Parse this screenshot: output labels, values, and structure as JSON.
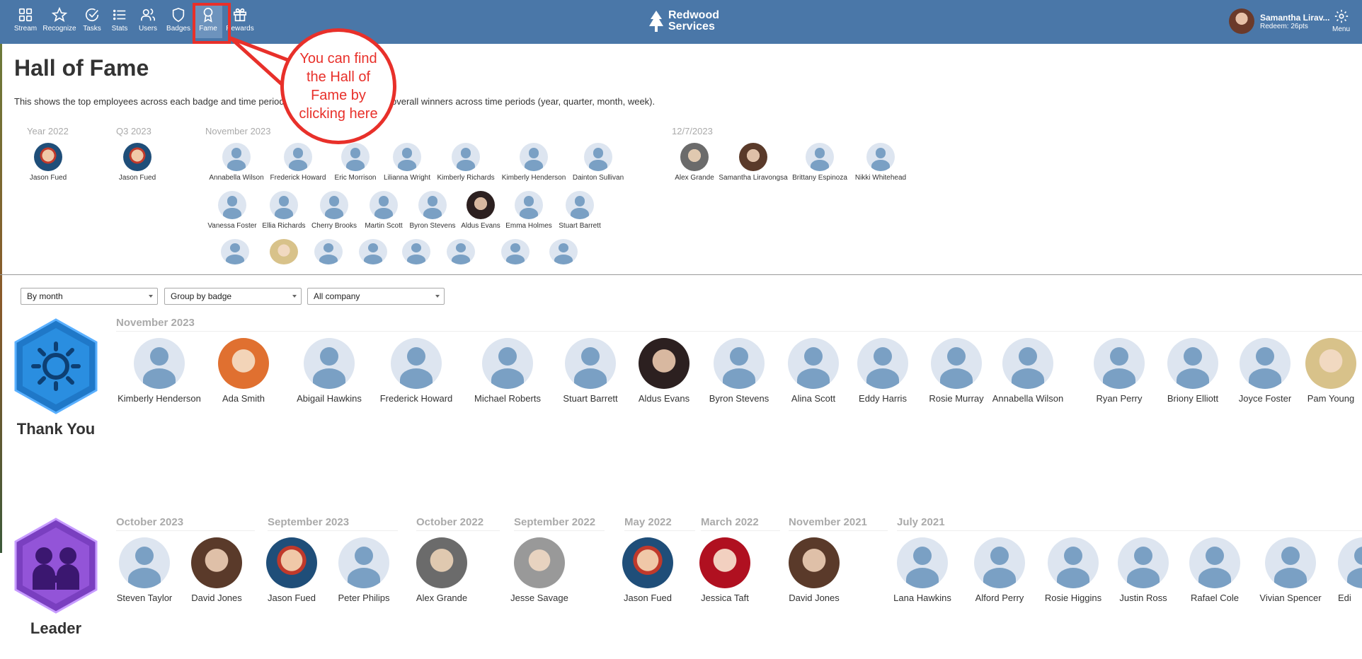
{
  "nav": {
    "items": [
      {
        "label": "Stream",
        "icon": "grid-icon"
      },
      {
        "label": "Recognize",
        "icon": "star-icon"
      },
      {
        "label": "Tasks",
        "icon": "check-circle-icon"
      },
      {
        "label": "Stats",
        "icon": "list-icon"
      },
      {
        "label": "Users",
        "icon": "users-icon"
      },
      {
        "label": "Badges",
        "icon": "shield-icon"
      },
      {
        "label": "Fame",
        "icon": "award-icon"
      },
      {
        "label": "Rewards",
        "icon": "gift-icon"
      }
    ],
    "active": "Fame"
  },
  "brand": {
    "line1": "Redwood",
    "line2": "Services"
  },
  "user": {
    "name": "Samantha Lirav...",
    "points": "Redeem: 26pts"
  },
  "menu": {
    "label": "Menu"
  },
  "page": {
    "title": "Hall of Fame",
    "desc_left": "This shows the top employees across each badge and time period",
    "desc_right": "ht is overall winners across time periods (year, quarter, month, week)."
  },
  "overview": {
    "year": {
      "label": "Year 2022",
      "people": [
        "Jason Fued"
      ]
    },
    "quarter": {
      "label": "Q3 2023",
      "people": [
        "Jason Fued"
      ]
    },
    "month": {
      "label": "November 2023",
      "row1": [
        "Annabella Wilson",
        "Frederick Howard",
        "Eric Morrison",
        "Lilianna Wright",
        "Kimberly Richards",
        "Kimberly Henderson",
        "Dainton Sullivan"
      ],
      "row2": [
        "Vanessa Foster",
        "Ellia Richards",
        "Cherry Brooks",
        "Martin Scott",
        "Byron Stevens",
        "Aldus Evans",
        "Emma Holmes",
        "Stuart Barrett"
      ]
    },
    "week": {
      "label": "12/7/2023",
      "people": [
        "Alex Grande",
        "Samantha Liravongsa",
        "Brittany Espinoza",
        "Nikki Whitehead"
      ]
    }
  },
  "filters": {
    "period": "By month",
    "group": "Group by badge",
    "scope": "All company"
  },
  "badges": {
    "thankyou": {
      "title": "Thank You",
      "period": "November 2023",
      "people": [
        "Kimberly Henderson",
        "Ada Smith",
        "Abigail Hawkins",
        "Frederick Howard",
        "Michael Roberts",
        "Stuart Barrett",
        "Aldus Evans",
        "Byron Stevens",
        "Alina Scott",
        "Eddy Harris",
        "Rosie Murray",
        "Annabella Wilson",
        "Ryan Perry",
        "Briony Elliott",
        "Joyce Foster",
        "Pam Young"
      ]
    },
    "leader": {
      "title": "Leader",
      "periods": [
        "October 2023",
        "September 2023",
        "October 2022",
        "September 2022",
        "May 2022",
        "March 2022",
        "November 2021",
        "July 2021"
      ],
      "people": [
        "Steven Taylor",
        "David Jones",
        "Jason Fued",
        "Peter Philips",
        "Alex Grande",
        "Jesse Savage",
        "Jason Fued",
        "Jessica Taft",
        "David Jones",
        "Lana Hawkins",
        "Alford Perry",
        "Rosie Higgins",
        "Justin Ross",
        "Rafael Cole",
        "Vivian Spencer",
        "Edi"
      ]
    }
  },
  "callout": {
    "text": "You can find the Hall of Fame by clicking here"
  },
  "colors": {
    "topbar": "#4a77a8",
    "accent_red": "#e8302a",
    "badge_blue": "#1f78c8",
    "badge_purple": "#7a3fc0"
  }
}
